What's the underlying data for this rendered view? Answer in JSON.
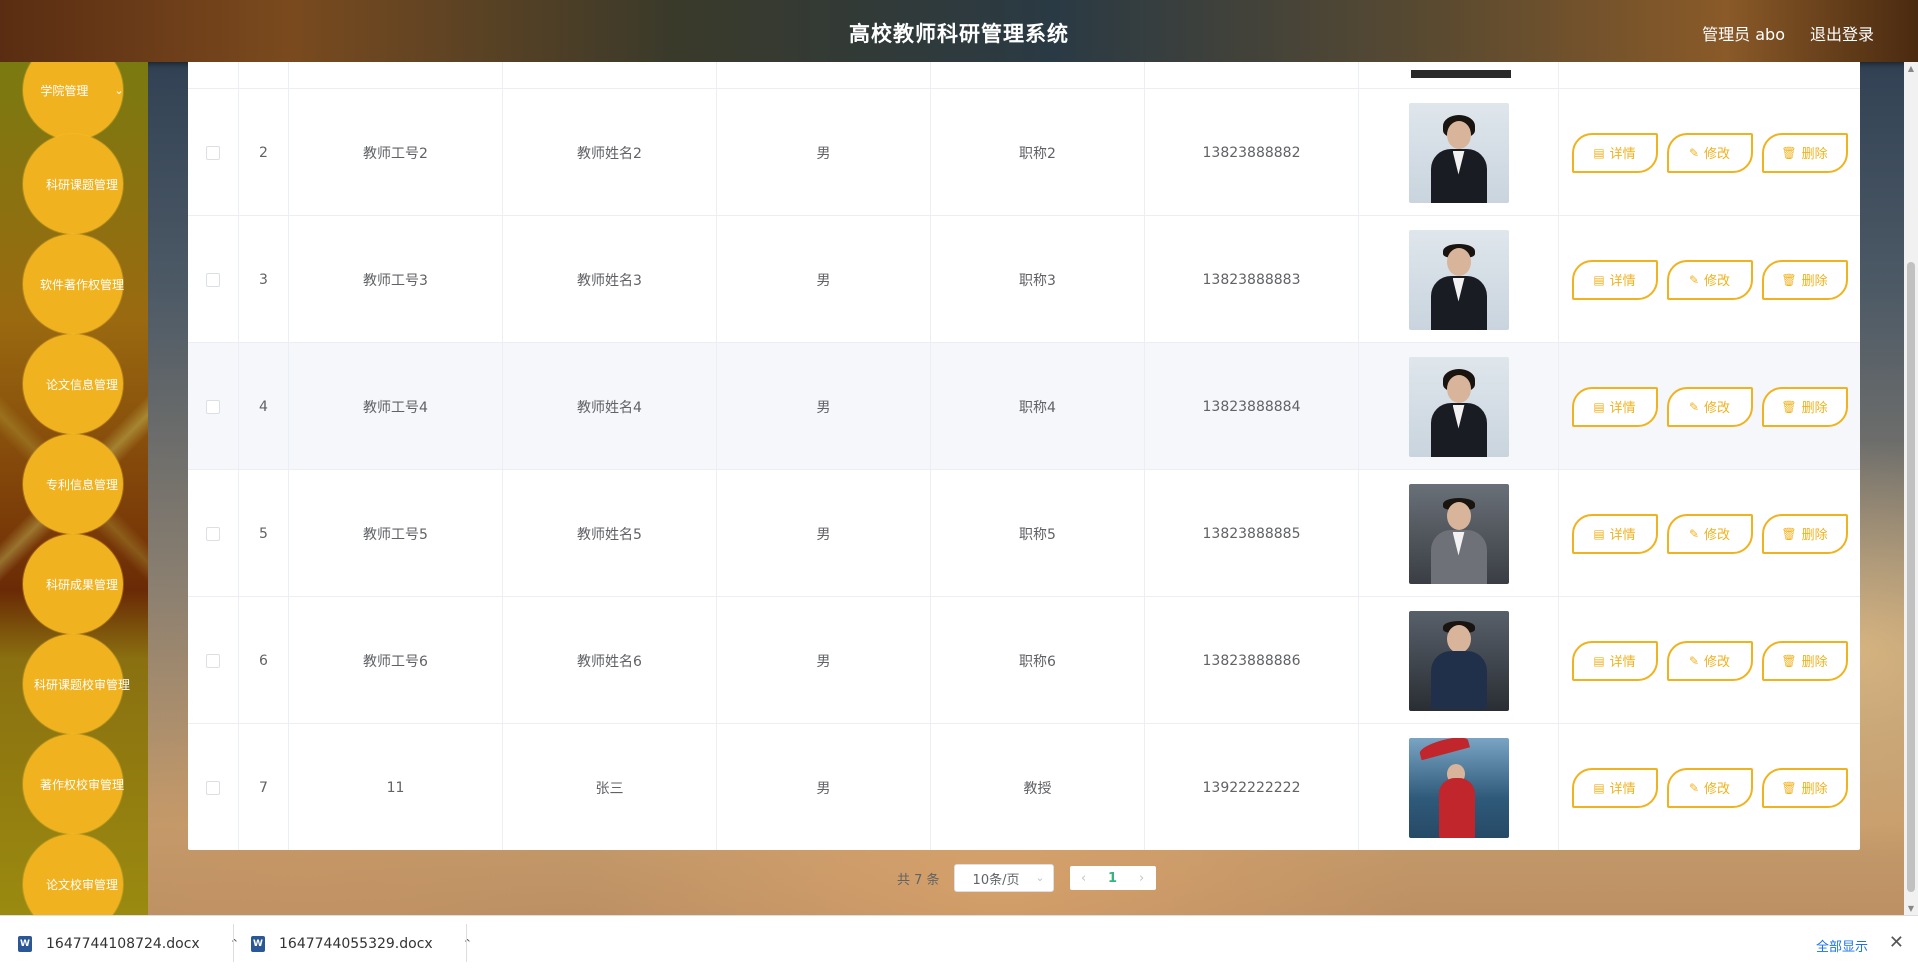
{
  "header": {
    "title": "高校教师科研管理系统",
    "user": "管理员 abo",
    "logout": "退出登录"
  },
  "sidebar": {
    "items": [
      {
        "label": "学院管理",
        "chevron": "chevron-down-icon"
      },
      {
        "label": "科研课题管理"
      },
      {
        "label": "软件著作权管理"
      },
      {
        "label": "论文信息管理"
      },
      {
        "label": "专利信息管理"
      },
      {
        "label": "科研成果管理"
      },
      {
        "label": "科研课题校审管理"
      },
      {
        "label": "著作权校审管理"
      },
      {
        "label": "论文校审管理"
      }
    ]
  },
  "table": {
    "rows": [
      {
        "index": "2",
        "teacher_id": "教师工号2",
        "name": "教师姓名2",
        "gender": "男",
        "title": "职称2",
        "phone": "13823888882",
        "photo": "female-suit"
      },
      {
        "index": "3",
        "teacher_id": "教师工号3",
        "name": "教师姓名3",
        "gender": "男",
        "title": "职称3",
        "phone": "13823888883",
        "photo": "male-suit"
      },
      {
        "index": "4",
        "teacher_id": "教师工号4",
        "name": "教师姓名4",
        "gender": "男",
        "title": "职称4",
        "phone": "13823888884",
        "photo": "female-suit"
      },
      {
        "index": "5",
        "teacher_id": "教师工号5",
        "name": "教师姓名5",
        "gender": "男",
        "title": "职称5",
        "phone": "13823888885",
        "photo": "male-gray-suit"
      },
      {
        "index": "6",
        "teacher_id": "教师工号6",
        "name": "教师姓名6",
        "gender": "男",
        "title": "职称6",
        "phone": "13823888886",
        "photo": "male-seated"
      },
      {
        "index": "7",
        "teacher_id": "11",
        "name": "张三",
        "gender": "男",
        "title": "教授",
        "phone": "13922222222",
        "photo": "woman-umbrella"
      }
    ],
    "actions": {
      "detail": "详情",
      "edit": "修改",
      "delete": "删除"
    }
  },
  "pagination": {
    "total": "共 7 条",
    "page_size": "10条/页",
    "current_page": "1",
    "prev_icon": "chevron-left-icon",
    "next_icon": "chevron-right-icon"
  },
  "downloads": {
    "files": [
      "1647744108724.docx",
      "1647744055329.docx"
    ],
    "show_all": "全部显示",
    "file_icon": "word-doc-icon"
  },
  "colors": {
    "accent": "#f0b21e",
    "pager_active": "#36b37e"
  }
}
